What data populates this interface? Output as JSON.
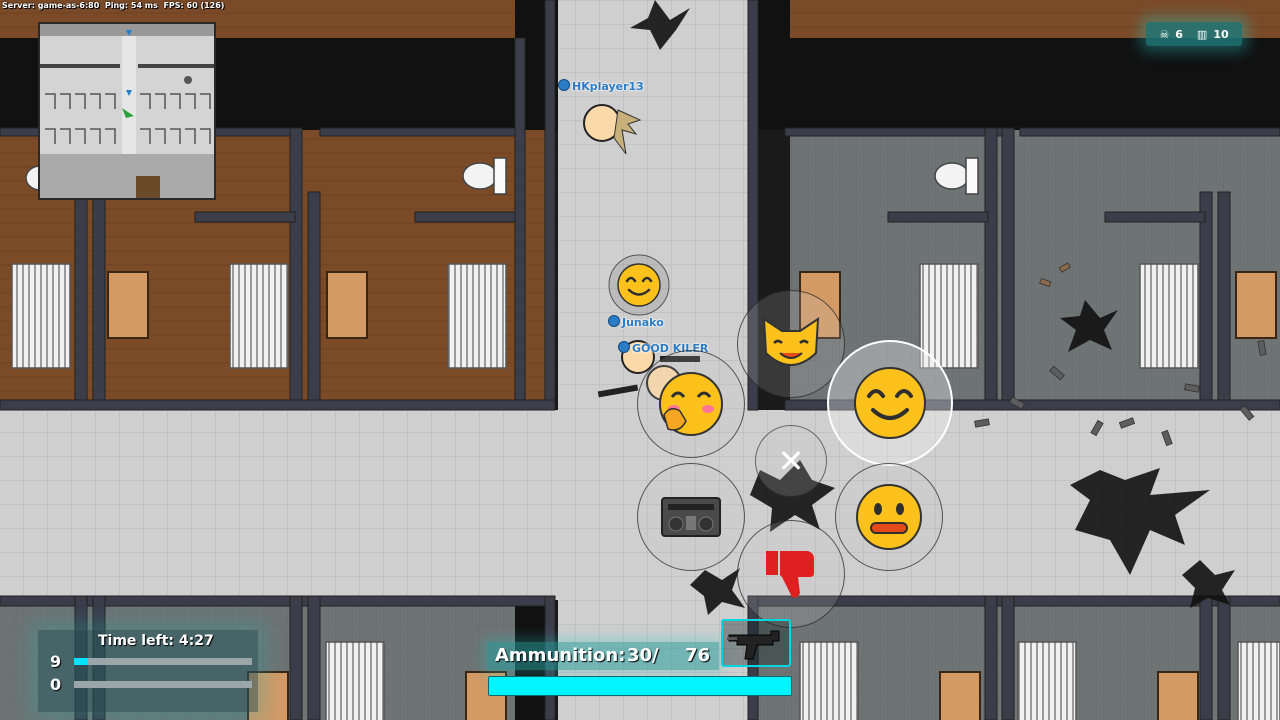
{
  "server_info": "Server: game-as-6:80  Ping: 54 ms  FPS: 60 (126)",
  "kills_box": {
    "skull_icon": "skull-icon",
    "kills": "6",
    "players_icon": "players-icon",
    "players": "10"
  },
  "players": [
    {
      "name": "HKplayer13",
      "color": "#2a7cc7"
    },
    {
      "name": "Junako",
      "color": "#2a7cc7"
    },
    {
      "name": "GOOD KILER",
      "color": "#2a7cc7"
    }
  ],
  "emote_wheel": {
    "emotes": [
      "cat-face-emote",
      "smile-emote",
      "shy-blush-emote",
      "neutral-face-emote",
      "boombox-emote",
      "thumbs-down-emote"
    ],
    "selected": "smile-emote",
    "close_symbol": "✕"
  },
  "timer": {
    "label": "Time left:",
    "value": "4:27"
  },
  "teams": [
    {
      "score": "9",
      "progress": 0.08,
      "color": "#00e5ff"
    },
    {
      "score": "0",
      "progress": 0.0,
      "color": "#00e5ff"
    }
  ],
  "ammo": {
    "label": "Ammunition:",
    "current": "30/",
    "total": "76",
    "fill": 1.0
  },
  "weapon": {
    "icon": "smg-weapon-icon"
  },
  "colors": {
    "accent": "#00e5ff",
    "floor_wood": "#7a4d2b",
    "floor_tile": "#c8c8c8",
    "walls": "#3b3d4a"
  }
}
